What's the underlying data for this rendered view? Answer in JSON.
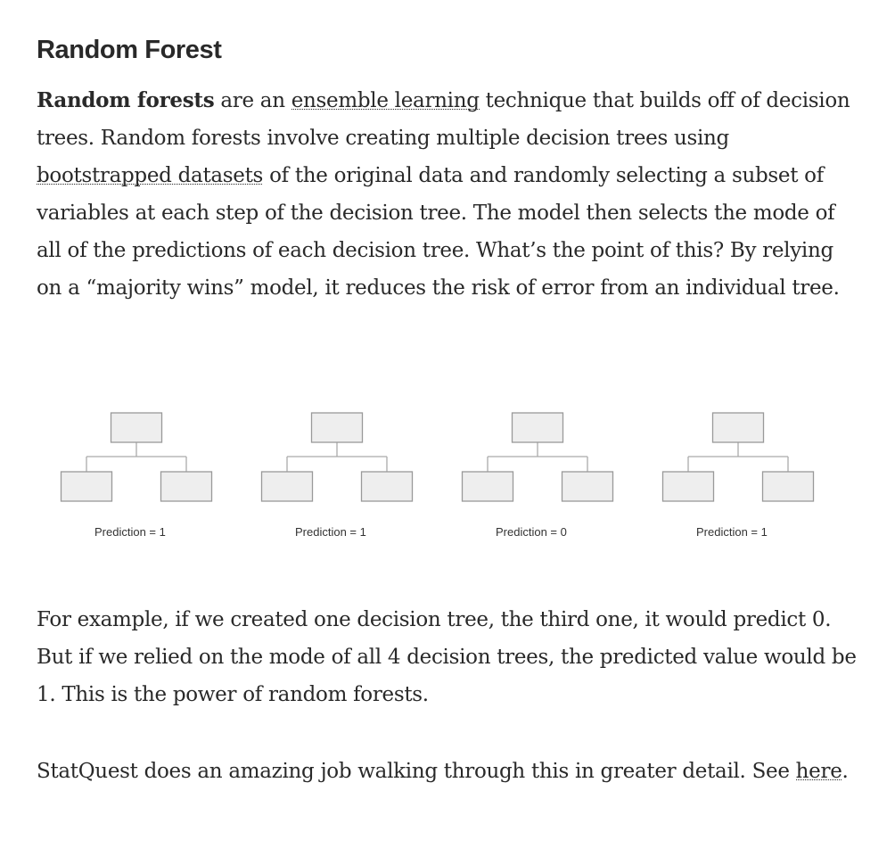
{
  "section": {
    "title": "Random Forest"
  },
  "paragraph1": {
    "bold_lead": "Random forests",
    "text_a": " are an ",
    "link_ensemble": "ensemble learning",
    "text_b": " technique that builds off of decision trees. Random forests involve creating multiple decision trees using ",
    "link_bootstrapped": "bootstrapped datasets",
    "text_c": " of the original data and randomly selecting a subset of variables at each step of the decision tree. The model then selects the mode of all of the predictions of each decision tree. What’s the point of this? By relying on a “majority wins” model, it reduces the risk of error from an individual tree."
  },
  "figure": {
    "trees": [
      {
        "prediction_label": "Prediction = 1"
      },
      {
        "prediction_label": "Prediction = 1"
      },
      {
        "prediction_label": "Prediction = 0"
      },
      {
        "prediction_label": "Prediction = 1"
      }
    ],
    "colors": {
      "node_fill": "#eeeeee",
      "node_stroke": "#999999",
      "edge_stroke": "#aaaaaa"
    }
  },
  "paragraph2": {
    "text": "For example, if we created one decision tree, the third one, it would predict 0. But if we relied on the mode of all 4 decision trees, the predicted value would be 1. This is the power of random forests."
  },
  "paragraph3": {
    "text_a": "StatQuest does an amazing job walking through this in greater detail. See ",
    "link_here": "here",
    "text_b": "."
  }
}
